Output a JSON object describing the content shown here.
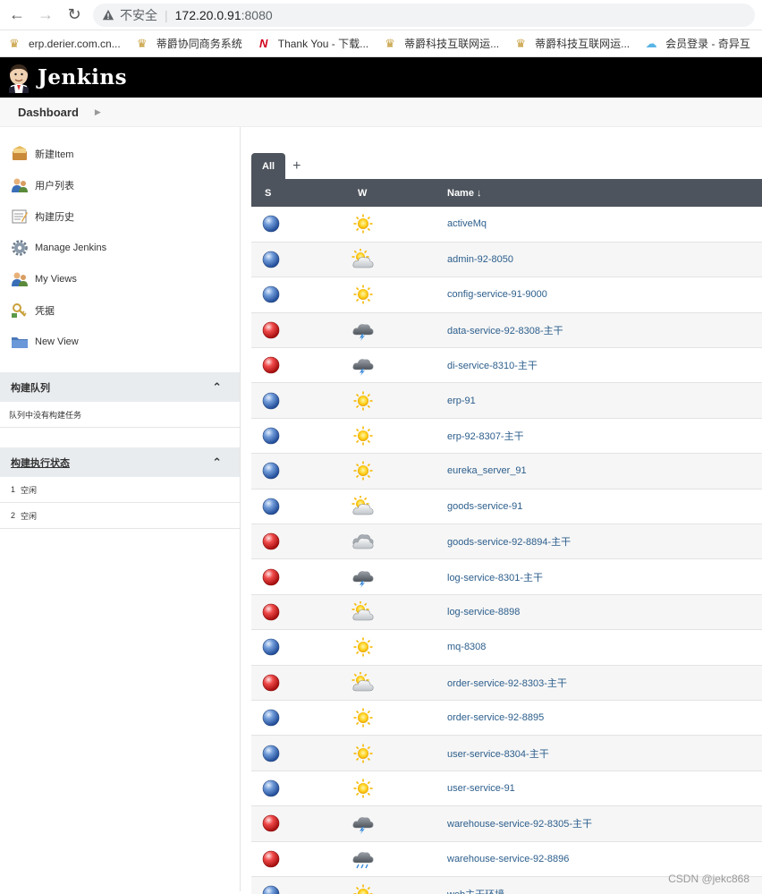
{
  "browser": {
    "insecure_label": "不安全",
    "url_host": "172.20.0.91",
    "url_port": ":8080",
    "bookmarks": [
      {
        "label": "erp.derier.com.cn...",
        "icon": "crown-icon"
      },
      {
        "label": "蒂爵协同商务系统",
        "icon": "crown-icon"
      },
      {
        "label": "Thank You - 下载...",
        "icon": "n-logo-icon"
      },
      {
        "label": "蒂爵科技互联网运...",
        "icon": "crown-icon"
      },
      {
        "label": "蒂爵科技互联网运...",
        "icon": "crown-icon"
      },
      {
        "label": "会员登录 - 奇异互",
        "icon": "cloud-icon"
      }
    ]
  },
  "header": {
    "title": "Jenkins"
  },
  "breadcrumb": {
    "dashboard": "Dashboard"
  },
  "sidebar": {
    "tasks": [
      {
        "label": "新建Item",
        "icon": "new-item-icon"
      },
      {
        "label": "用户列表",
        "icon": "users-icon"
      },
      {
        "label": "构建历史",
        "icon": "notepad-icon"
      },
      {
        "label": "Manage Jenkins",
        "icon": "gear-icon"
      },
      {
        "label": "My Views",
        "icon": "users-icon"
      },
      {
        "label": "凭据",
        "icon": "key-icon"
      },
      {
        "label": "New View",
        "icon": "folder-icon"
      }
    ],
    "build_queue": {
      "title": "构建队列",
      "empty_text": "队列中没有构建任务"
    },
    "executors": {
      "title": "构建执行状态",
      "items": [
        {
          "num": "1",
          "status": "空闲"
        },
        {
          "num": "2",
          "status": "空闲"
        }
      ]
    }
  },
  "views": {
    "active_tab": "All",
    "add_tab": "+"
  },
  "table": {
    "col_s": "S",
    "col_w": "W",
    "col_name": "Name ↓",
    "rows": [
      {
        "status": "blue",
        "weather": "sunny",
        "name": "activeMq"
      },
      {
        "status": "blue",
        "weather": "partly-cloudy",
        "name": "admin-92-8050"
      },
      {
        "status": "blue",
        "weather": "sunny",
        "name": "config-service-91-9000"
      },
      {
        "status": "red",
        "weather": "storm",
        "name": "data-service-92-8308-主干"
      },
      {
        "status": "red",
        "weather": "storm",
        "name": "di-service-8310-主干"
      },
      {
        "status": "blue",
        "weather": "sunny",
        "name": "erp-91"
      },
      {
        "status": "blue",
        "weather": "sunny",
        "name": "erp-92-8307-主干"
      },
      {
        "status": "blue",
        "weather": "sunny",
        "name": "eureka_server_91"
      },
      {
        "status": "blue",
        "weather": "partly-cloudy",
        "name": "goods-service-91"
      },
      {
        "status": "red",
        "weather": "cloudy",
        "name": "goods-service-92-8894-主干"
      },
      {
        "status": "red",
        "weather": "storm",
        "name": "log-service-8301-主干"
      },
      {
        "status": "red",
        "weather": "partly-cloudy",
        "name": "log-service-8898"
      },
      {
        "status": "blue",
        "weather": "sunny",
        "name": "mq-8308"
      },
      {
        "status": "red",
        "weather": "partly-cloudy",
        "name": "order-service-92-8303-主干"
      },
      {
        "status": "blue",
        "weather": "sunny",
        "name": "order-service-92-8895"
      },
      {
        "status": "blue",
        "weather": "sunny",
        "name": "user-service-8304-主干"
      },
      {
        "status": "blue",
        "weather": "sunny",
        "name": "user-service-91"
      },
      {
        "status": "red",
        "weather": "storm",
        "name": "warehouse-service-92-8305-主干"
      },
      {
        "status": "red",
        "weather": "rain",
        "name": "warehouse-service-92-8896"
      },
      {
        "status": "blue",
        "weather": "sunny",
        "name": "web主干环境"
      }
    ]
  },
  "colors": {
    "header_bg": "#000000",
    "table_header_bg": "#4d545d",
    "link": "#2c5e8c",
    "status_blue": "#4a78c2",
    "status_red": "#e02828"
  },
  "watermark": "CSDN @jekc868"
}
